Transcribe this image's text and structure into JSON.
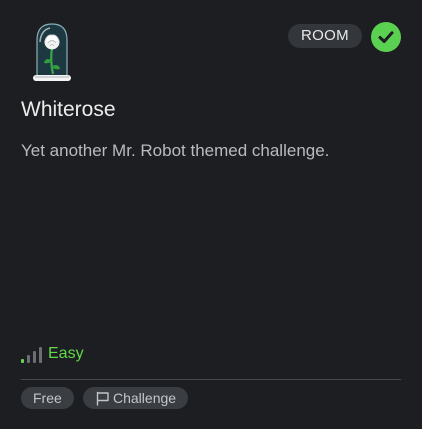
{
  "card": {
    "type_badge": "ROOM",
    "title": "Whiterose",
    "description": "Yet another Mr. Robot themed challenge.",
    "difficulty": "Easy",
    "tags": [
      "Free",
      "Challenge"
    ],
    "icons": {
      "room": "white-rose-bell-jar-icon",
      "completed": "check-circle-icon",
      "difficulty": "signal-bars-icon",
      "challenge": "flag-icon"
    },
    "colors": {
      "completed": "#5ad150",
      "difficulty": "#63d84b",
      "background": "#1c1e21"
    }
  }
}
